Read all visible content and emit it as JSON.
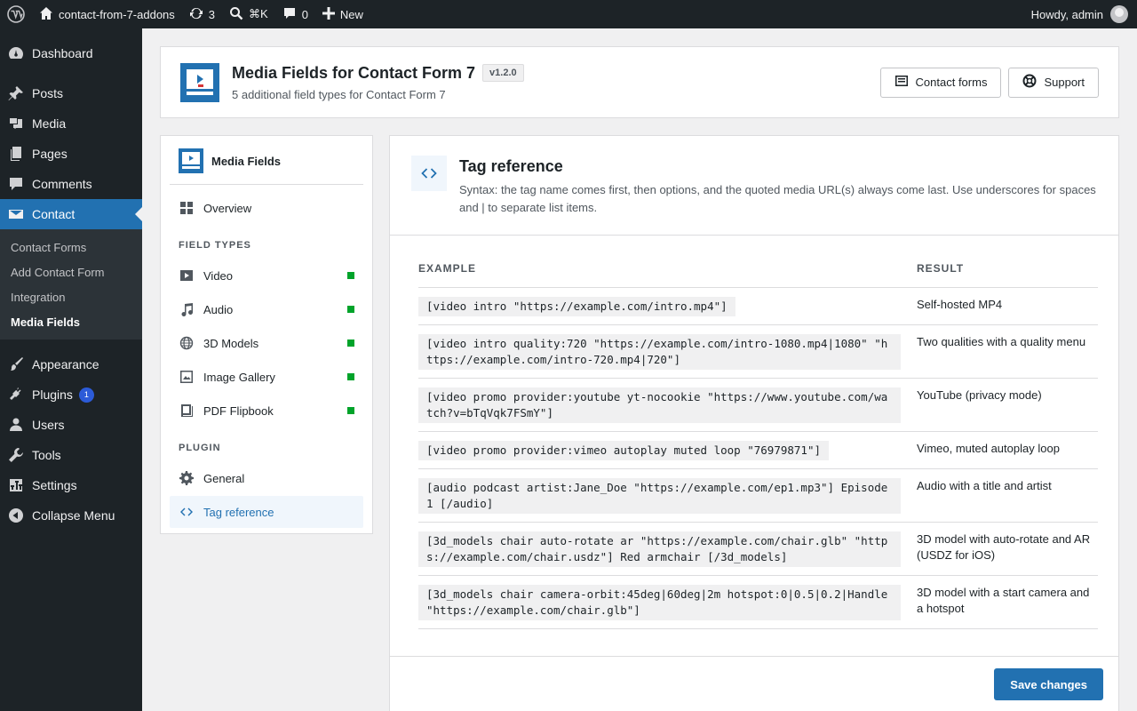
{
  "adminbar": {
    "site_name": "contact-from-7-addons",
    "updates_count": "3",
    "search_shortcut": "⌘K",
    "comments_count": "0",
    "new_label": "New",
    "howdy": "Howdy, admin"
  },
  "menu": {
    "dashboard": "Dashboard",
    "posts": "Posts",
    "media": "Media",
    "pages": "Pages",
    "comments": "Comments",
    "contact": "Contact",
    "contact_sub": [
      "Contact Forms",
      "Add Contact Form",
      "Integration",
      "Media Fields"
    ],
    "appearance": "Appearance",
    "plugins": "Plugins",
    "plugins_badge": "1",
    "users": "Users",
    "tools": "Tools",
    "settings": "Settings",
    "collapse": "Collapse Menu"
  },
  "header": {
    "title": "Media Fields for Contact Form 7",
    "version": "v1.2.0",
    "subtitle": "5 additional field types for Contact Form 7",
    "contact_forms_button": "Contact forms",
    "support_button": "Support"
  },
  "nav": {
    "title": "Media Fields",
    "overview": "Overview",
    "field_types_heading": "FIELD TYPES",
    "video": "Video",
    "audio": "Audio",
    "models": "3D Models",
    "gallery": "Image Gallery",
    "flipbook": "PDF Flipbook",
    "plugin_heading": "PLUGIN",
    "general": "General",
    "tag_reference": "Tag reference"
  },
  "main": {
    "title": "Tag reference",
    "description": "Syntax: the tag name comes first, then options, and the quoted media URL(s) always come last. Use underscores for spaces and | to separate list items.",
    "col_example": "EXAMPLE",
    "col_result": "RESULT",
    "rows": [
      {
        "example": "[video intro \"https://example.com/intro.mp4\"]",
        "result": "Self-hosted MP4"
      },
      {
        "example": "[video intro quality:720 \"https://example.com/intro-1080.mp4|1080\" \"https://example.com/intro-720.mp4|720\"]",
        "result": "Two qualities with a quality menu"
      },
      {
        "example": "[video promo provider:youtube yt-nocookie \"https://www.youtube.com/watch?v=bTqVqk7FSmY\"]",
        "result": "YouTube (privacy mode)"
      },
      {
        "example": "[video promo provider:vimeo autoplay muted loop \"76979871\"]",
        "result": "Vimeo, muted autoplay loop"
      },
      {
        "example": "[audio podcast artist:Jane_Doe \"https://example.com/ep1.mp3\"] Episode 1 [/audio]",
        "result": "Audio with a title and artist"
      },
      {
        "example": "[3d_models chair auto-rotate ar \"https://example.com/chair.glb\" \"https://example.com/chair.usdz\"] Red armchair [/3d_models]",
        "result": "3D model with auto-rotate and AR (USDZ for iOS)"
      },
      {
        "example": "[3d_models chair camera-orbit:45deg|60deg|2m hotspot:0|0.5|0.2|Handle \"https://example.com/chair.glb\"]",
        "result": "3D model with a start camera and a hotspot"
      }
    ],
    "save_button": "Save changes"
  }
}
